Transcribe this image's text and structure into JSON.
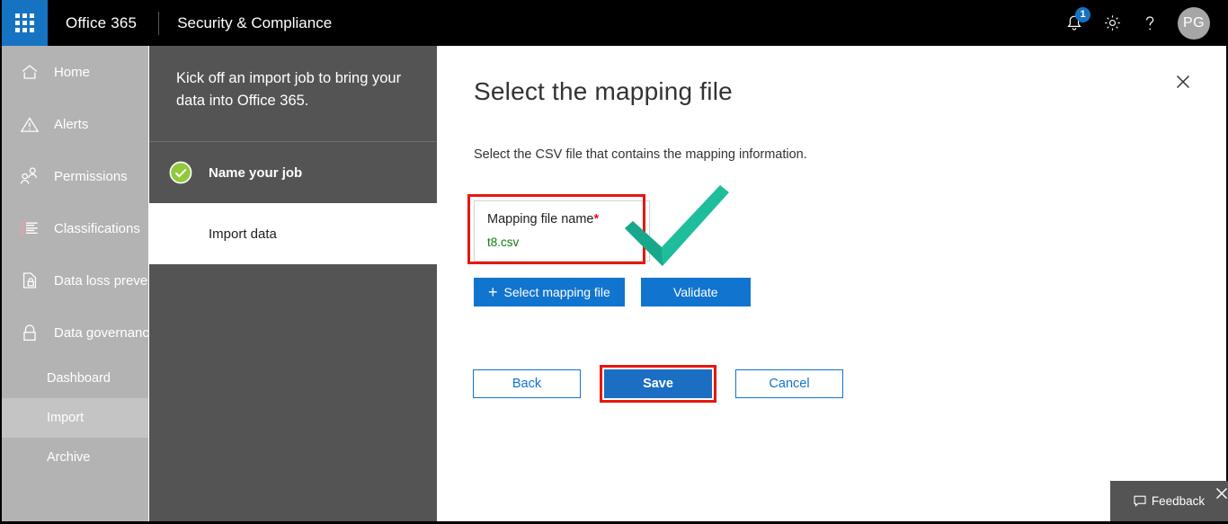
{
  "suitebar": {
    "waffle_name": "app-launcher",
    "brand": "Office 365",
    "app_name": "Security & Compliance",
    "notification_count": "1",
    "settings_icon": "gear-icon",
    "help_icon": "question-mark-icon",
    "avatar_initials": "PG"
  },
  "sidebar": {
    "items": [
      {
        "label": "Home",
        "icon": "home-icon"
      },
      {
        "label": "Alerts",
        "icon": "warning-triangle-icon"
      },
      {
        "label": "Permissions",
        "icon": "people-icon"
      },
      {
        "label": "Classifications",
        "icon": "list-icon"
      },
      {
        "label": "Data loss prevention",
        "icon": "document-lock-icon"
      },
      {
        "label": "Data governance",
        "icon": "lock-icon"
      }
    ],
    "subitems": [
      {
        "label": "Dashboard",
        "active": false
      },
      {
        "label": "Import",
        "active": true
      },
      {
        "label": "Archive",
        "active": false
      }
    ]
  },
  "steppanel": {
    "intro": "Kick off an import job to bring your data into Office 365.",
    "steps": [
      {
        "label": "Name your job",
        "state": "done",
        "icon": "green-check-circle-icon"
      },
      {
        "label": "Import data",
        "state": "todo",
        "icon": "grey-dot-icon"
      }
    ]
  },
  "main": {
    "title": "Select the mapping file",
    "subtitle": "Select the CSV file that contains the mapping information.",
    "close_icon": "close-icon",
    "file_field": {
      "label": "Mapping file name",
      "required_mark": "*",
      "value": "t8.csv"
    },
    "actions": {
      "select_mapping_file": "Select mapping file",
      "select_mapping_file_icon": "plus-icon",
      "validate": "Validate"
    },
    "footer": {
      "back": "Back",
      "save": "Save",
      "cancel": "Cancel"
    },
    "annotation_icon": "green-checkmark-annotation"
  },
  "feedback": {
    "label": "Feedback",
    "icon": "speech-bubble-icon",
    "close_icon": "close-icon"
  },
  "colors": {
    "accent_blue": "#1174cf",
    "waffle_blue": "#1673c2",
    "highlight_red": "#e8170f",
    "success_green": "#107c10",
    "annotation_teal": "#1fbd9c",
    "sidebar_grey": "#b3b3b3",
    "panel_dark": "#545454"
  }
}
